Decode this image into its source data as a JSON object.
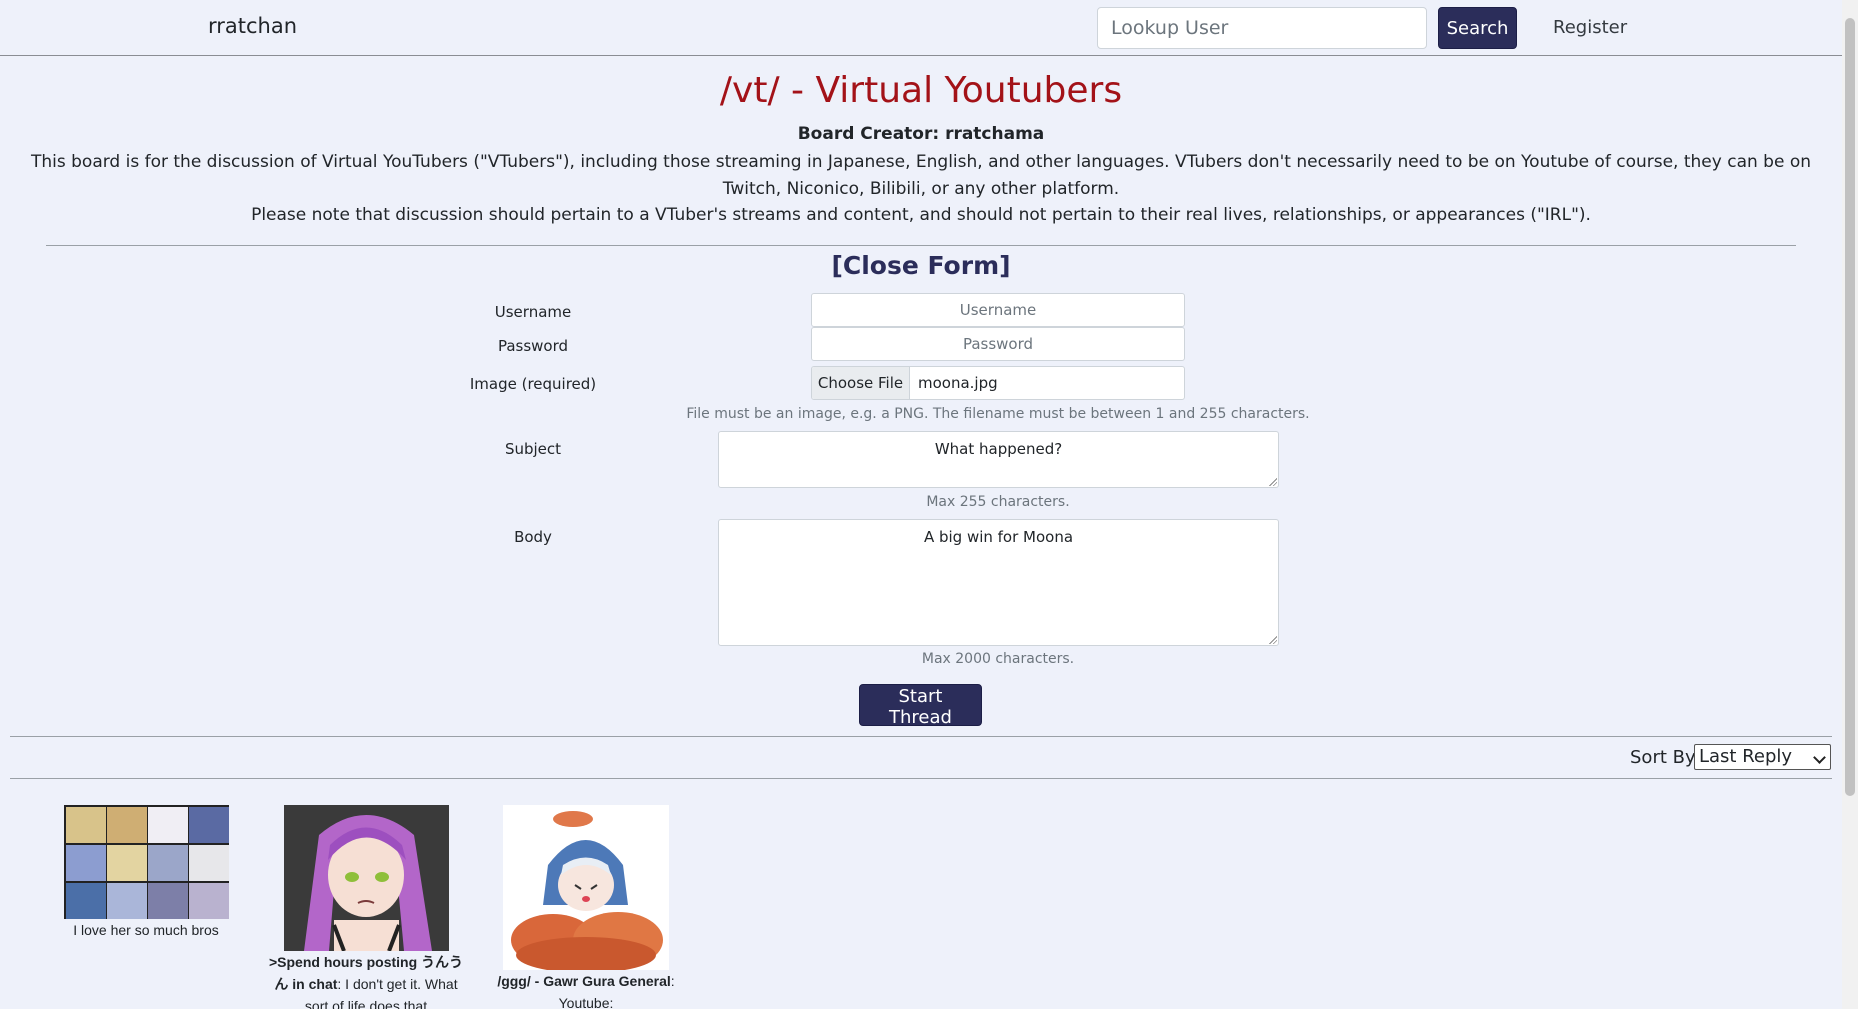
{
  "header": {
    "brand": "rratchan",
    "search_placeholder": "Lookup User",
    "search_label": "Search",
    "register_label": "Register"
  },
  "board": {
    "title": "/vt/ - Virtual Youtubers",
    "creator": "Board Creator: rratchama",
    "description": "This board is for the discussion of Virtual YouTubers (\"VTubers\"), including those streaming in Japanese, English, and other languages. VTubers don't necessarily need to be on Youtube of course, they can be on Twitch, Niconico, Bilibili, or any other platform.",
    "note": "Please note that discussion should pertain to a VTuber's streams and content, and should not pertain to their real lives, relationships, or appearances (\"IRL\")."
  },
  "form": {
    "close_label": "[Close Form]",
    "username_label": "Username",
    "username_placeholder": "Username",
    "password_label": "Password",
    "password_placeholder": "Password",
    "image_label": "Image (required)",
    "file_button": "Choose File",
    "file_name": "moona.jpg",
    "image_help": "File must be an image, e.g. a PNG. The filename must be between 1 and 255 characters.",
    "subject_label": "Subject",
    "subject_value": "What happened?",
    "subject_help": "Max 255 characters.",
    "body_label": "Body",
    "body_value": "A big win for Moona",
    "body_help": "Max 2000 characters.",
    "submit_label": "Start Thread"
  },
  "sort": {
    "label": "Sort By:",
    "selected": "Last Reply"
  },
  "threads": [
    {
      "text": "I love her so much bros"
    },
    {
      "subject_a": ">Spend hours posting うんうん in chat",
      "rest": ": I don't get it. What sort of life does that"
    },
    {
      "subject": "/ggg/ - Gawr Gura General",
      "rest": ": Youtube:"
    }
  ],
  "colors": {
    "accent": "#2b2d5a",
    "title": "#a31218",
    "background": "#eef1fa"
  }
}
